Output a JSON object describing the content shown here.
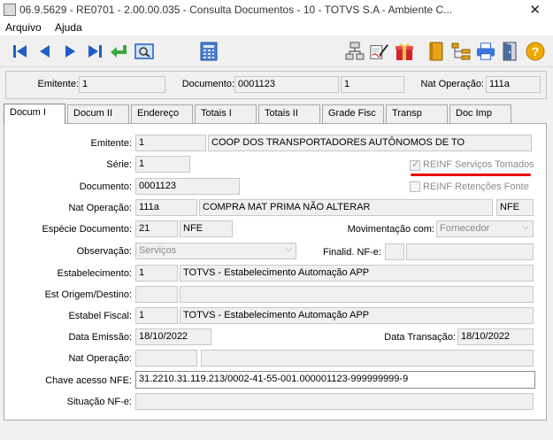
{
  "window": {
    "title": "06.9.5629 - RE0701 - 2.00.00.035 - Consulta Documentos - 10 - TOTVS S.A - Ambiente C...",
    "close_glyph": "✕"
  },
  "menu": {
    "items": [
      "Arquivo",
      "Ajuda"
    ]
  },
  "toolbar": {
    "left": [
      "first-icon",
      "previous-icon",
      "next-icon",
      "last-icon",
      "return-icon",
      "view-icon",
      "calculator-icon"
    ],
    "right": [
      "network-icon",
      "sign-icon",
      "gift-icon",
      "book-icon",
      "tree-icon",
      "print-icon",
      "exit-icon",
      "help-icon"
    ],
    "colors": {
      "nav": "#1e5fc7",
      "help": "#f0a800",
      "return": "#3da83a"
    }
  },
  "header": {
    "emitente_label": "Emitente:",
    "emitente_value": "1",
    "documento_label": "Documento:",
    "documento_value": "0001123",
    "documento_extra": "1",
    "natop_label": "Nat Operação:",
    "natop_value": "111a"
  },
  "tabs": [
    "Docum I",
    "Docum II",
    "Endereço",
    "Totais I",
    "Totais II",
    "Grade Fisc",
    "Transp",
    "Doc Imp"
  ],
  "form": {
    "emitente_label": "Emitente:",
    "emitente_code": "1",
    "emitente_name": "COOP DOS TRANSPORTADORES AUTÔNOMOS DE TO",
    "serie_label": "Série:",
    "serie_value": "1",
    "documento_label": "Documento:",
    "documento_value": "0001123",
    "reinf_tomados_label": "REINF Serviços Tomados",
    "reinf_tomados_checked": true,
    "reinf_retencoes_label": "REINF Retenções Fonte",
    "reinf_retencoes_checked": false,
    "natop_label": "Nat Operação:",
    "natop_code": "111a",
    "natop_desc": "COMPRA MAT PRIMA NÃO ALTERAR",
    "natop_type": "NFE",
    "especie_label": "Espécie Documento:",
    "especie_code": "21",
    "especie_type": "NFE",
    "movimentacao_label": "Movimentação com:",
    "movimentacao_value": "Fornecedor",
    "observacao_label": "Observação:",
    "observacao_value": "Serviços",
    "finalid_label": "Finalid. NF-e:",
    "estab_label": "Estabelecimento:",
    "estab_code": "1",
    "estab_name": "TOTVS - Estabelecimento Automação APP",
    "origem_label": "Est Origem/Destino:",
    "fiscal_label": "Estabel Fiscal:",
    "fiscal_code": "1",
    "fiscal_name": "TOTVS - Estabelecimento Automação APP",
    "emissao_label": "Data Emissão:",
    "emissao_value": "18/10/2022",
    "transacao_label": "Data Transação:",
    "transacao_value": "18/10/2022",
    "natop2_label": "Nat Operação:",
    "chave_label": "Chave acesso NFE:",
    "chave_value": "31.2210.31.119.213/0002-41-55-001.000001123-999999999-9",
    "situacao_label": "Situação NF-e:"
  },
  "annotation": {
    "underline_color": "#e8000b"
  }
}
